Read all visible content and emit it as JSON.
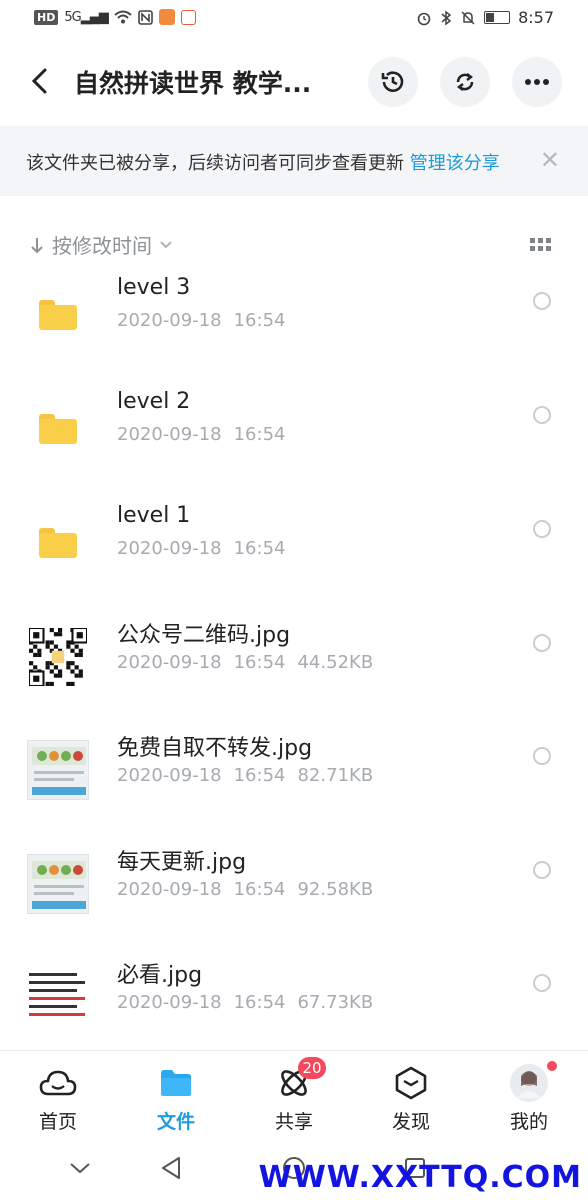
{
  "status_bar": {
    "network_badge": "HD",
    "signal": "5G",
    "time": "8:57"
  },
  "header": {
    "title": "自然拼读世界 教学..."
  },
  "banner": {
    "text": "该文件夹已被分享，后续访问者可同步查看更新",
    "link": "管理该分享",
    "close": "✕"
  },
  "sort": {
    "label": "按修改时间"
  },
  "files": [
    {
      "name": "level 3",
      "date": "2020-09-18",
      "time": "16:54",
      "size": "",
      "type": "folder"
    },
    {
      "name": "level 2",
      "date": "2020-09-18",
      "time": "16:54",
      "size": "",
      "type": "folder"
    },
    {
      "name": "level 1",
      "date": "2020-09-18",
      "time": "16:54",
      "size": "",
      "type": "folder"
    },
    {
      "name": "公众号二维码.jpg",
      "date": "2020-09-18",
      "time": "16:54",
      "size": "44.52KB",
      "type": "qr"
    },
    {
      "name": "免费自取不转发.jpg",
      "date": "2020-09-18",
      "time": "16:54",
      "size": "82.71KB",
      "type": "image"
    },
    {
      "name": "每天更新.jpg",
      "date": "2020-09-18",
      "time": "16:54",
      "size": "92.58KB",
      "type": "image"
    },
    {
      "name": "必看.jpg",
      "date": "2020-09-18",
      "time": "16:54",
      "size": "67.73KB",
      "type": "text-image"
    }
  ],
  "bottom_nav": [
    {
      "label": "首页",
      "icon": "cloud-icon"
    },
    {
      "label": "文件",
      "icon": "folder-icon"
    },
    {
      "label": "共享",
      "icon": "atom-icon",
      "badge": "20"
    },
    {
      "label": "发现",
      "icon": "cube-icon"
    },
    {
      "label": "我的",
      "icon": "avatar-icon"
    }
  ],
  "watermark": "WWW.XXTTQ.COM",
  "colors": {
    "accent": "#1d9be3",
    "link": "#1c9bd8",
    "badge": "#f3485d",
    "folder": "#f9cf4a"
  }
}
